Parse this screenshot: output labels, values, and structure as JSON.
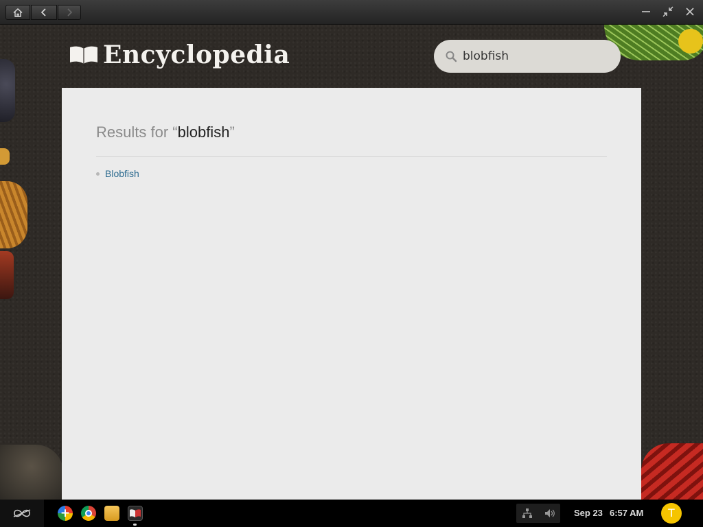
{
  "titlebar": {
    "home_icon": "home-icon",
    "back_icon": "chevron-left-icon",
    "forward_icon": "chevron-right-icon",
    "minimize_icon": "minimize-icon",
    "restore_icon": "restore-icon",
    "close_icon": "close-icon"
  },
  "header": {
    "title": "Encyclopedia",
    "logo_icon": "open-book-icon"
  },
  "search": {
    "value": "blobfish",
    "icon": "search-icon"
  },
  "results": {
    "prefix": "Results for ",
    "open_quote": "“",
    "query": "blobfish",
    "close_quote": "”",
    "items": [
      {
        "label": "Blobfish"
      }
    ]
  },
  "taskbar": {
    "menu_icon": "infinity-icon",
    "apps": [
      "add-app-icon",
      "chrome-icon",
      "files-icon",
      "encyclopedia-app-icon"
    ],
    "tray": [
      "network-icon",
      "volume-icon"
    ],
    "date": "Sep 23",
    "time": "6:57 AM",
    "user_initial": "T"
  },
  "colors": {
    "accent_link": "#2b6a8f",
    "avatar": "#f5c400",
    "panel": "#ebebeb"
  }
}
